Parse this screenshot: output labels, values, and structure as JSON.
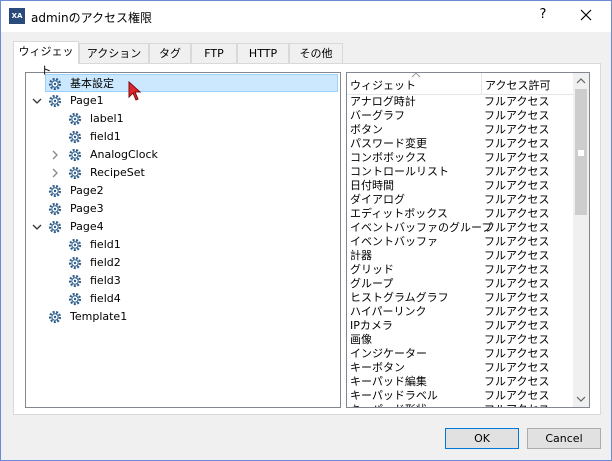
{
  "window": {
    "title": "adminのアクセス権限",
    "help": "?",
    "app_icon": "XA"
  },
  "tabs": [
    {
      "label": "ウィジェット"
    },
    {
      "label": "アクション"
    },
    {
      "label": "タグ"
    },
    {
      "label": "FTP"
    },
    {
      "label": "HTTP"
    },
    {
      "label": "その他"
    }
  ],
  "tree": [
    {
      "label": "基本設定"
    },
    {
      "label": "Page1"
    },
    {
      "label": "label1"
    },
    {
      "label": "field1"
    },
    {
      "label": "AnalogClock"
    },
    {
      "label": "RecipeSet"
    },
    {
      "label": "Page2"
    },
    {
      "label": "Page3"
    },
    {
      "label": "Page4"
    },
    {
      "label": "field1"
    },
    {
      "label": "field2"
    },
    {
      "label": "field3"
    },
    {
      "label": "field4"
    },
    {
      "label": "Template1"
    }
  ],
  "list": {
    "columns": {
      "widget": "ウィジェット",
      "access": "アクセス許可"
    },
    "rows": [
      {
        "name": "アナログ時計",
        "access": "フルアクセス"
      },
      {
        "name": "バーグラフ",
        "access": "フルアクセス"
      },
      {
        "name": "ボタン",
        "access": "フルアクセス"
      },
      {
        "name": "パスワード変更",
        "access": "フルアクセス"
      },
      {
        "name": "コンボボックス",
        "access": "フルアクセス"
      },
      {
        "name": "コントロールリスト",
        "access": "フルアクセス"
      },
      {
        "name": "日付時間",
        "access": "フルアクセス"
      },
      {
        "name": "ダイアログ",
        "access": "フルアクセス"
      },
      {
        "name": "エディットボックス",
        "access": "フルアクセス"
      },
      {
        "name": "イベントバッファのグループ",
        "access": "フルアクセス"
      },
      {
        "name": "イベントバッファ",
        "access": "フルアクセス"
      },
      {
        "name": "計器",
        "access": "フルアクセス"
      },
      {
        "name": "グリッド",
        "access": "フルアクセス"
      },
      {
        "name": "グループ",
        "access": "フルアクセス"
      },
      {
        "name": "ヒストグラムグラフ",
        "access": "フルアクセス"
      },
      {
        "name": "ハイパーリンク",
        "access": "フルアクセス"
      },
      {
        "name": "IPカメラ",
        "access": "フルアクセス"
      },
      {
        "name": "画像",
        "access": "フルアクセス"
      },
      {
        "name": "インジケーター",
        "access": "フルアクセス"
      },
      {
        "name": "キーボタン",
        "access": "フルアクセス"
      },
      {
        "name": "キーパッド編集",
        "access": "フルアクセス"
      },
      {
        "name": "キーパッドラベル",
        "access": "フルアクセス"
      },
      {
        "name": "キーパッド形状",
        "access": "フルアクセス"
      }
    ]
  },
  "buttons": {
    "ok": "OK",
    "cancel": "Cancel"
  },
  "colors": {
    "selection": "#cce8ff",
    "accent": "#0078d7",
    "gear": "#2f5d8a"
  }
}
